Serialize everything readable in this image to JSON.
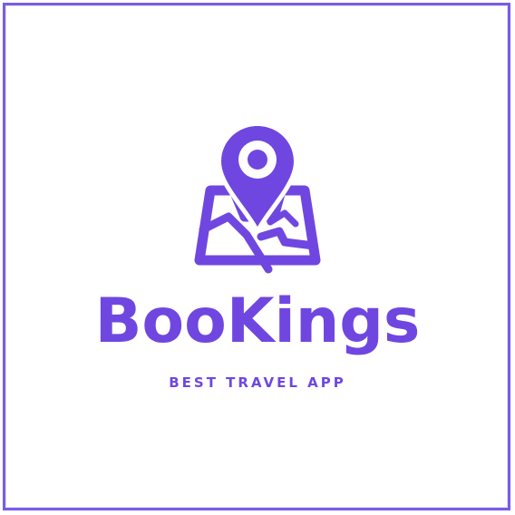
{
  "logo": {
    "icon": "map-location-pin-icon",
    "brand_name": "BooKings",
    "tagline": "BEST TRAVEL APP"
  },
  "colors": {
    "brand": "#6f47e0",
    "frame_border": "#7b5be6",
    "background": "#ffffff"
  }
}
